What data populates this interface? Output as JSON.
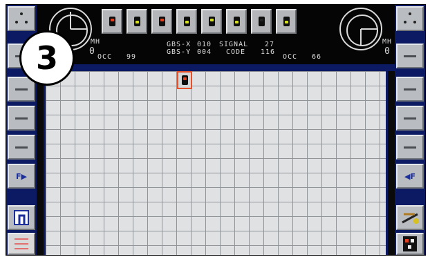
{
  "callout": {
    "number": "3"
  },
  "left_panel": {
    "f_key": "F▶"
  },
  "right_panel": {
    "f_key": "◀F"
  },
  "left_gauge": {
    "unit": "MH",
    "value": "0"
  },
  "right_gauge": {
    "unit": "MH",
    "value": "0"
  },
  "readouts": {
    "left_occ_label": "OCC",
    "left_occ_value": "99",
    "gbs_x_label": "GBS-X",
    "gbs_x_value": "010",
    "gbs_y_label": "GBS-Y",
    "gbs_y_value": "004",
    "signal_label": "SIGNAL",
    "signal_value": "27",
    "code_label": "CODE",
    "code_value": "116",
    "right_occ_label": "OCC",
    "right_occ_value": "66"
  },
  "signal_buttons": [
    {
      "icon": "red-signal-icon",
      "lamp": "#e0401e"
    },
    {
      "icon": "yellow-signal-icon",
      "lamp": "#d7e020"
    },
    {
      "icon": "red-yellow-signal-icon",
      "lamp": "#e0401e"
    },
    {
      "icon": "yellow-bracket-signal-icon",
      "lamp": "#d7e020"
    },
    {
      "icon": "yellow-signal-icon",
      "lamp": "#d7e020"
    },
    {
      "icon": "yellow-bracket-signal-icon",
      "lamp": "#d7e020"
    },
    {
      "icon": "dark-signal-icon",
      "lamp": "#222222"
    },
    {
      "icon": "yellow-diagonal-signal-icon",
      "lamp": "#d7e020"
    }
  ],
  "colors": {
    "panel_blue": "#0b1a63",
    "button_grey": "#b9bcc0",
    "grid_bg": "#e0e1e3",
    "cursor": "#e8502a"
  }
}
